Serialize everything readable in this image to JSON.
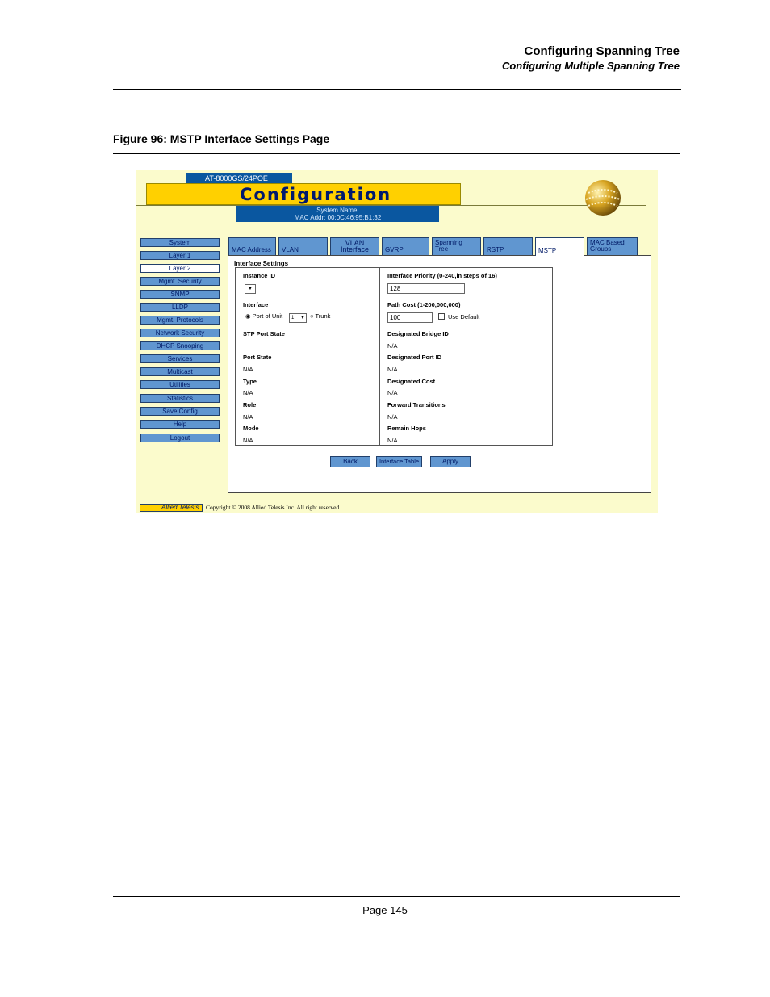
{
  "header": {
    "chapter_title": "Configuring Spanning Tree",
    "section_title": "Configuring Multiple Spanning Tree"
  },
  "figure": {
    "caption": "Figure 96:  MSTP Interface Settings Page"
  },
  "ui": {
    "model": "AT-8000GS/24POE",
    "banner": "Configuration",
    "system_name_label": "System Name:",
    "mac_label": "MAC Addr: 00:0C:46:95:B1:32",
    "nav": [
      "System",
      "Layer 1",
      "Layer 2",
      "Mgmt. Security",
      "SNMP",
      "LLDP",
      "Mgmt. Protocols",
      "Network Security",
      "DHCP Snooping",
      "Services",
      "Multicast",
      "Utilities",
      "Statistics",
      "Save Config",
      "Help",
      "Logout"
    ],
    "nav_active": "Layer 2",
    "tabs": {
      "mac_address": "MAC Address",
      "vlan": "VLAN",
      "vlan_interface_1": "VLAN",
      "vlan_interface_2": "Interface",
      "gvrp": "GVRP",
      "spanning_tree_1": "Spanning",
      "spanning_tree_2": "Tree",
      "rstp": "RSTP",
      "mstp": "MSTP",
      "mac_groups_1": "MAC Based",
      "mac_groups_2": "Groups"
    },
    "section_title": "Interface Settings",
    "left": {
      "instance_id_label": "Instance ID",
      "interface_label": "Interface",
      "port_of_unit_label": "Port of Unit",
      "unit_value": "1",
      "trunk_label": "Trunk",
      "stp_port_state_label": "STP Port State",
      "port_state_label": "Port State",
      "port_state_value": "N/A",
      "type_label": "Type",
      "type_value": "N/A",
      "role_label": "Role",
      "role_value": "N/A",
      "mode_label": "Mode",
      "mode_value": "N/A"
    },
    "right": {
      "priority_label": "Interface Priority (0-240,in steps of 16)",
      "priority_value": "128",
      "path_cost_label": "Path Cost (1-200,000,000)",
      "path_cost_value": "100",
      "use_default_label": "Use Default",
      "bridge_id_label": "Designated Bridge ID",
      "bridge_id_value": "N/A",
      "port_id_label": "Designated Port ID",
      "port_id_value": "N/A",
      "cost_label": "Designated Cost",
      "cost_value": "N/A",
      "transitions_label": "Forward Transitions",
      "transitions_value": "N/A",
      "hops_label": "Remain Hops",
      "hops_value": "N/A"
    },
    "buttons": {
      "back": "Back",
      "interface_table": "Interface Table",
      "apply": "Apply"
    },
    "footer": {
      "logo_text": "Allied Telesis",
      "copyright": "Copyright © 2008 Allied Telesis Inc. All right reserved."
    }
  },
  "page": {
    "number": "Page 145"
  }
}
